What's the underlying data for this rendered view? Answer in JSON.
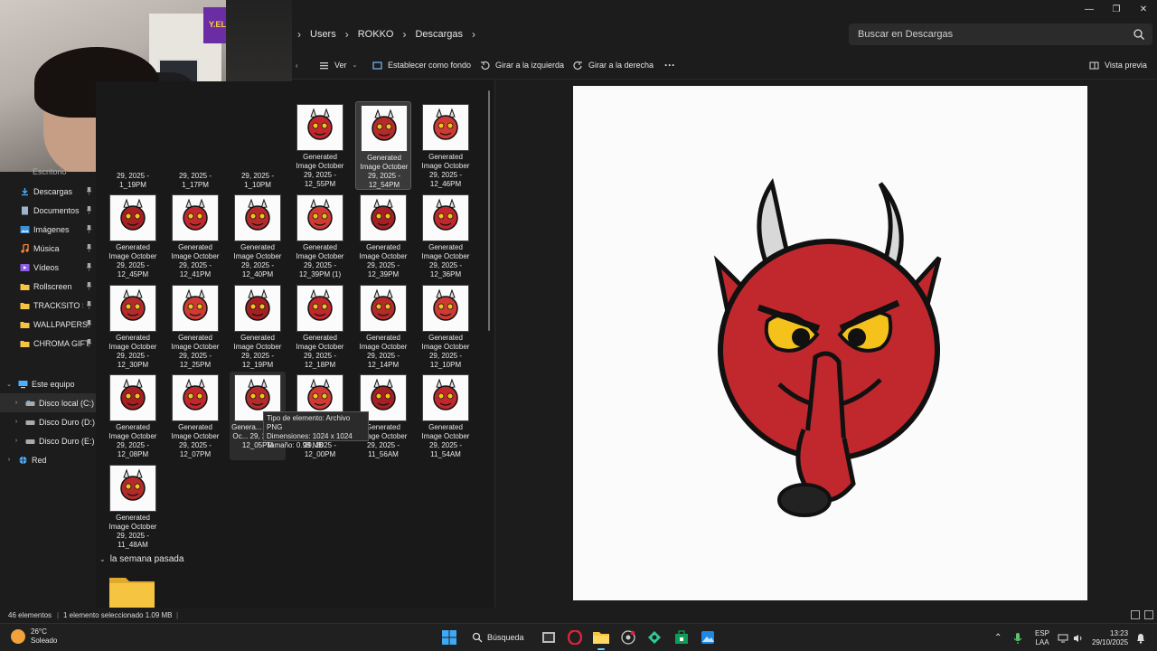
{
  "window": {
    "minimize": "—",
    "maximize": "❐",
    "close": "✕"
  },
  "address": {
    "crumbs": [
      "Users",
      "ROKKO",
      "Descargas"
    ],
    "search_placeholder": "Buscar en Descargas"
  },
  "toolbar": {
    "view_label": "Ver",
    "set_background_label": "Establecer como fondo",
    "rotate_left_label": "Girar a la izquierda",
    "rotate_right_label": "Girar a la derecha",
    "more_label": "···",
    "preview_label": "Vista previa"
  },
  "webcam": {
    "poster_text": "Y.ELAT"
  },
  "sidebar": {
    "partial_item": "Escritorio",
    "items": [
      {
        "label": "Descargas",
        "icon": "download-icon",
        "pinned": true
      },
      {
        "label": "Documentos",
        "icon": "document-icon",
        "pinned": true
      },
      {
        "label": "Imágenes",
        "icon": "image-icon",
        "pinned": true
      },
      {
        "label": "Música",
        "icon": "music-icon",
        "pinned": true
      },
      {
        "label": "Vídeos",
        "icon": "video-icon",
        "pinned": true
      },
      {
        "label": "Rollscreen",
        "icon": "folder-icon",
        "pinned": true
      },
      {
        "label": "TRACKSITO SUAVE",
        "icon": "folder-icon",
        "pinned": true
      },
      {
        "label": "WALLPAPERS",
        "icon": "folder-icon",
        "pinned": true
      },
      {
        "label": "CHROMA GIFT",
        "icon": "folder-icon",
        "pinned": true
      }
    ],
    "this_pc": "Este equipo",
    "drives": [
      "Disco local (C:)",
      "Disco Duro (D:)",
      "Disco Duro (E:)"
    ],
    "network": "Red"
  },
  "files": {
    "partial_row": [
      "29, 2025 - 1_19PM",
      "29, 2025 - 1_17PM",
      "29, 2025 - 1_10PM"
    ],
    "row0": [
      {
        "name": "Generated Image October 29, 2025 - 12_55PM",
        "selected": false
      },
      {
        "name": "Generated Image October 29, 2025 - 12_54PM",
        "selected": true
      },
      {
        "name": "Generated Image October 29, 2025 - 12_46PM",
        "selected": false
      }
    ],
    "row1": [
      "Generated Image October 29, 2025 - 12_45PM",
      "Generated Image October 29, 2025 - 12_41PM",
      "Generated Image October 29, 2025 - 12_40PM",
      "Generated Image October 29, 2025 - 12_39PM (1)",
      "Generated Image October 29, 2025 - 12_39PM",
      "Generated Image October 29, 2025 - 12_36PM"
    ],
    "row2": [
      "Generated Image October 29, 2025 - 12_30PM",
      "Generated Image October 29, 2025 - 12_25PM",
      "Generated Image October 29, 2025 - 12_19PM",
      "Generated Image October 29, 2025 - 12_18PM",
      "Generated Image October 29, 2025 - 12_14PM",
      "Generated Image October 29, 2025 - 12_10PM"
    ],
    "row3": [
      "Generated Image October 29, 2025 - 12_08PM",
      "Generated Image October 29, 2025 - 12_07PM",
      "Genera... Image Oc... 29, 2025 - 12_05PM",
      "Generated Image October 29, 2025 - 12_00PM",
      "Generated Image October 29, 2025 - 11_56AM",
      "Generated Image October 29, 2025 - 11_54AM"
    ],
    "row3_partial": {
      "a": "Genera",
      "b": "Image Oc",
      "c": "29, 2025 -",
      "d": "12_05PM",
      "e": "29, 2025 -",
      "f": "12_00PM",
      "g": "Image October",
      "h": "29, 2025 -",
      "i": "11_56AM",
      "j": "Generated",
      "k": "29, 2025 -"
    },
    "row4": [
      "Generated Image October 29, 2025 - 11_48AM"
    ],
    "group_last_week": "la semana pasada"
  },
  "tooltip": {
    "line1": "Tipo de elemento: Archivo PNG",
    "line2": "Dimensiones: 1024 x 1024",
    "line3": "Tamaño: 0.98 MB"
  },
  "status": {
    "count": "46 elementos",
    "selected": "1 elemento seleccionado  1.09 MB"
  },
  "taskbar": {
    "temp": "26°C",
    "condition": "Soleado",
    "search_label": "Búsqueda",
    "lang1": "ESP",
    "lang2": "LAA",
    "time": "13:23",
    "date": "29/10/2025"
  },
  "colors": {
    "accent": "#60cdff",
    "devil_red": "#c0282d",
    "folder": "#f5c542"
  }
}
